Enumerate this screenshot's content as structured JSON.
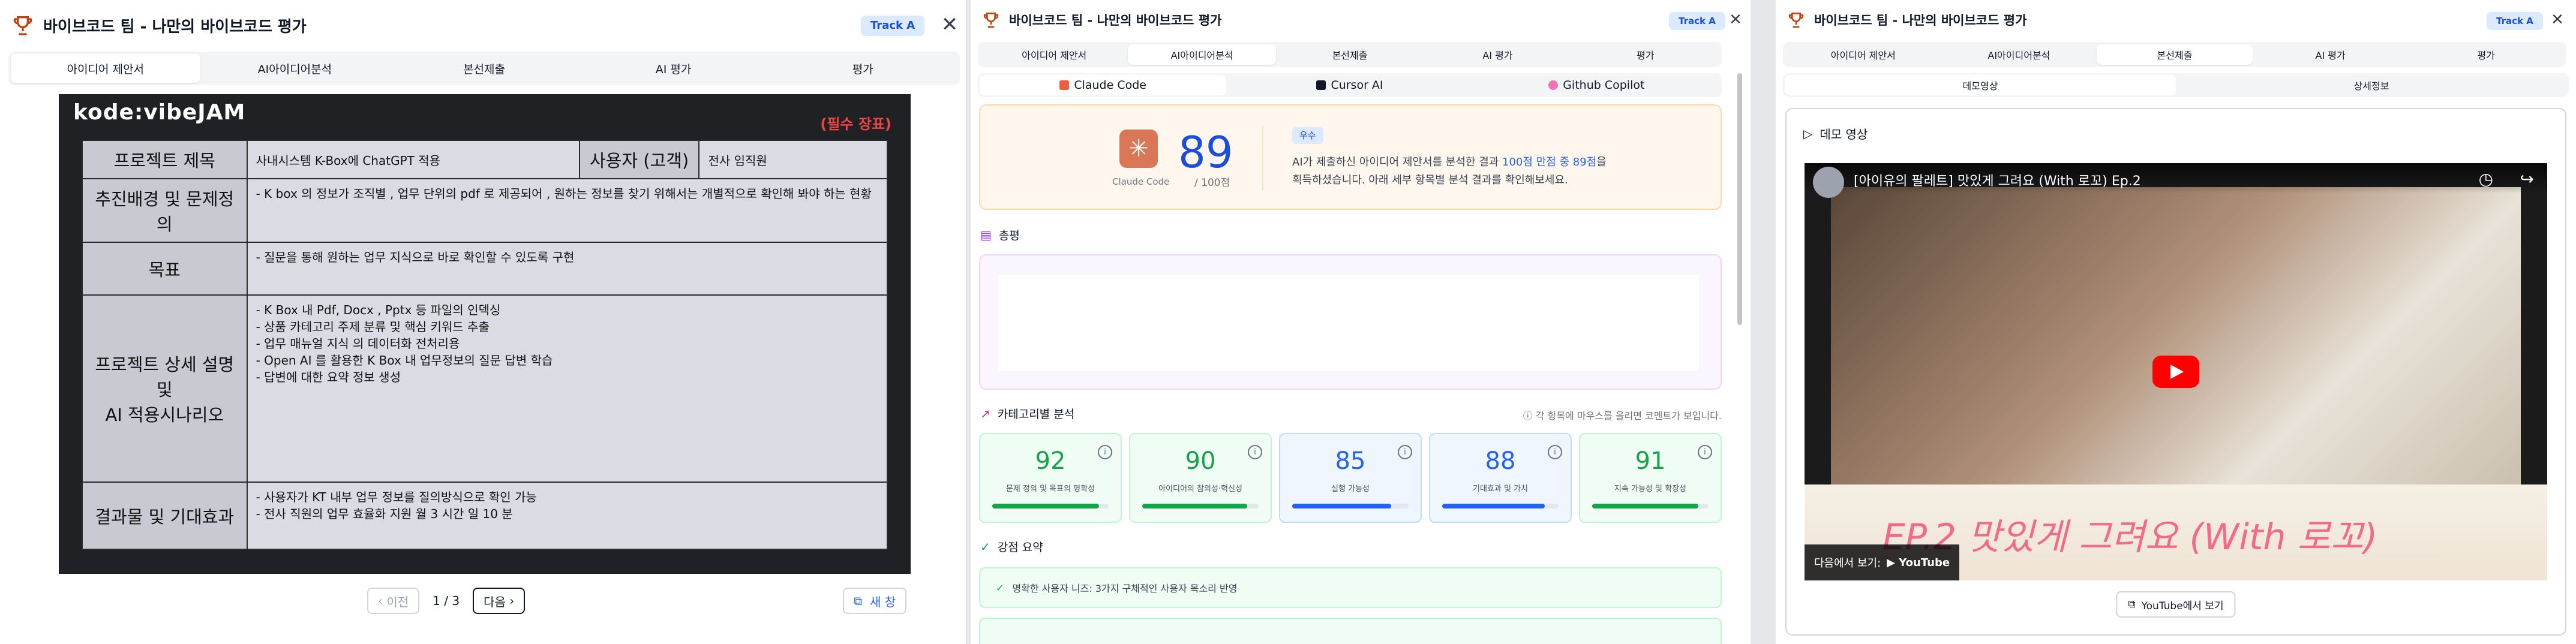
{
  "window_title": "바이브코드 팀 - 나만의 바이브코드 평가",
  "track_badge": "Track A",
  "close_glyph": "✕",
  "tabs": [
    "아이디어 제안서",
    "AI아이디어분석",
    "본선제출",
    "AI 평가",
    "평가"
  ],
  "panel1": {
    "slide": {
      "logo": "kode:vibeJAM",
      "required_note": "(필수 장표)",
      "rows": [
        {
          "label": "프로젝트 제목",
          "value": "사내시스템 K-Box에 ChatGPT 적용",
          "label2": "사용자 (고객)",
          "value2": "전사 임직원"
        },
        {
          "label": "추진배경 및 문제정의",
          "lines": [
            "- K box 의 정보가 조직별 , 업무 단위의 pdf 로 제공되어 , 원하는 정보를 찾기 위해서는 개별적으로 확인해 봐야 하는 현황"
          ]
        },
        {
          "label": "목표",
          "lines": [
            "- 질문을 통해 원하는 업무 지식으로 바로 확인할 수 있도록 구현"
          ]
        },
        {
          "label": "프로젝트 상세 설명\n및\nAI 적용시나리오",
          "lines": [
            "- K Box 내 Pdf, Docx , Pptx 등 파일의 인덱싱",
            "- 상품 카테고리 주제 분류 및 핵심 키워드 추출",
            "- 업무 매뉴얼 지식 의 데이터화 전처리용",
            "- Open AI 를 활용한 K Box 내 업무정보의 질문 답변 학습",
            "- 답변에 대한 요약 정보 생성"
          ]
        },
        {
          "label": "결과물 및 기대효과",
          "lines": [
            "- 사용자가 KT 내부 업무 정보를 질의방식으로 확인 가능",
            "- 전사 직원의 업무 효율화 지원 월 3 시간 일 10 분"
          ]
        }
      ]
    },
    "pager": {
      "prev": "이전",
      "page": "1 / 3",
      "next": "다음",
      "new_window": "새 창"
    }
  },
  "panel2": {
    "subtabs": [
      "Claude Code",
      "Cursor AI",
      "Github Copilot"
    ],
    "score": {
      "tool_label": "Claude Code",
      "value": "89",
      "out_of": "/ 100점",
      "grade": "우수",
      "desc_pre": "AI가 제출하신 아이디어 제안서를 분석한 결과 ",
      "desc_hl": "100점 만점 중 89점",
      "desc_post": "을",
      "desc_line2": "획득하셨습니다. 아래 세부 항목별 분석 결과를 확인해보세요."
    },
    "summary_title": "총평",
    "category_title": "카테고리별 분석",
    "category_note": "각 항목에 마우스를 올리면 코멘트가 보입니다.",
    "categories": [
      {
        "score": "92",
        "label": "문제 정의 및 목표의 명확성",
        "value": 92,
        "color": "#16a34a",
        "bg": "#f0fdf4",
        "border": "#bbf7d0"
      },
      {
        "score": "90",
        "label": "아이디어의 참의성·혁신성",
        "value": 90,
        "color": "#16a34a",
        "bg": "#f0fdf4",
        "border": "#bbf7d0"
      },
      {
        "score": "85",
        "label": "실행 가능성",
        "value": 85,
        "color": "#2563eb",
        "bg": "#eff6ff",
        "border": "#bfdbfe"
      },
      {
        "score": "88",
        "label": "기대효과 및 가치",
        "value": 88,
        "color": "#2563eb",
        "bg": "#eff6ff",
        "border": "#bfdbfe"
      },
      {
        "score": "91",
        "label": "지속 가능성 및 확장성",
        "value": 91,
        "color": "#16a34a",
        "bg": "#f0fdf4",
        "border": "#bbf7d0"
      }
    ],
    "strength_title": "강점 요약",
    "strength_item": "명확한 사용자 니즈: 3가지 구체적인 사용자 목소리 반영"
  },
  "panel3": {
    "subtabs": [
      "데모영상",
      "상세정보"
    ],
    "demo_title": "데모 영상",
    "video_title": "[아이유의 팔레트] 맛있게 그려요 (With 로꼬) Ep.2",
    "video_slogan": "EP.2 맛있게 그려요 (With 로꼬)",
    "watch_on": "다음에서 보기:",
    "youtube": "YouTube",
    "youtube_button": "YouTube에서 보기"
  }
}
